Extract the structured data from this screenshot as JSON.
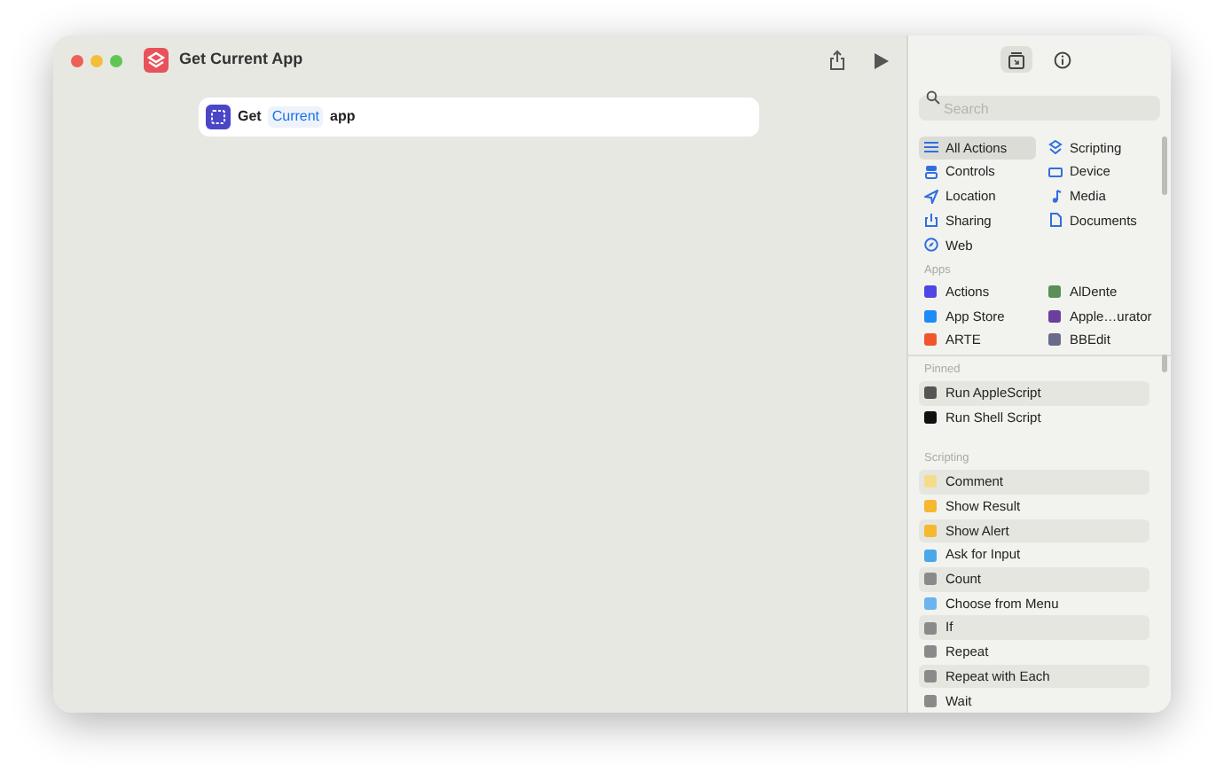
{
  "window": {
    "title": "Get Current App"
  },
  "editor": {
    "actions": [
      {
        "parts": [
          {
            "kind": "text",
            "text": "Get"
          },
          {
            "kind": "token",
            "text": "Current"
          },
          {
            "kind": "text",
            "text": "app"
          }
        ]
      }
    ]
  },
  "sidebar": {
    "tabs": [
      {
        "kind": "library",
        "selected": true
      },
      {
        "kind": "info",
        "selected": false
      }
    ],
    "search": {
      "placeholder": "Search"
    },
    "categories": [
      {
        "label": "All Actions",
        "selected": true
      },
      {
        "label": "Scripting",
        "selected": false
      },
      {
        "label": "Controls",
        "selected": false
      },
      {
        "label": "Device",
        "selected": false
      },
      {
        "label": "Location",
        "selected": false
      },
      {
        "label": "Media",
        "selected": false
      },
      {
        "label": "Sharing",
        "selected": false
      },
      {
        "label": "Documents",
        "selected": false
      },
      {
        "label": "Web",
        "selected": false
      }
    ],
    "apps_heading": "Apps",
    "apps": [
      {
        "label": "Actions",
        "color": "#4f46e5"
      },
      {
        "label": "AlDente",
        "color": "#5a8f5a"
      },
      {
        "label": "App Store",
        "color": "#1d8cf8"
      },
      {
        "label": "Apple…urator",
        "color": "#6b3fa0"
      },
      {
        "label": "ARTE",
        "color": "#f0562a"
      },
      {
        "label": "BBEdit",
        "color": "#6a6a8a"
      }
    ],
    "sections": [
      {
        "heading": "Pinned",
        "items": [
          {
            "label": "Run AppleScript",
            "color": "#555555"
          },
          {
            "label": "Run Shell Script",
            "color": "#111111"
          }
        ]
      },
      {
        "heading": "Scripting",
        "items": [
          {
            "label": "Comment",
            "color": "#f5dc8a"
          },
          {
            "label": "Show Result",
            "color": "#f5b82e"
          },
          {
            "label": "Show Alert",
            "color": "#f5b82e"
          },
          {
            "label": "Ask for Input",
            "color": "#4aa8e8"
          },
          {
            "label": "Count",
            "color": "#8a8a8a"
          },
          {
            "label": "Choose from Menu",
            "color": "#6ab4f0"
          },
          {
            "label": "If",
            "color": "#8a8a8a"
          },
          {
            "label": "Repeat",
            "color": "#8a8a8a"
          },
          {
            "label": "Repeat with Each",
            "color": "#8a8a8a"
          },
          {
            "label": "Wait",
            "color": "#8a8a8a"
          }
        ]
      }
    ]
  }
}
